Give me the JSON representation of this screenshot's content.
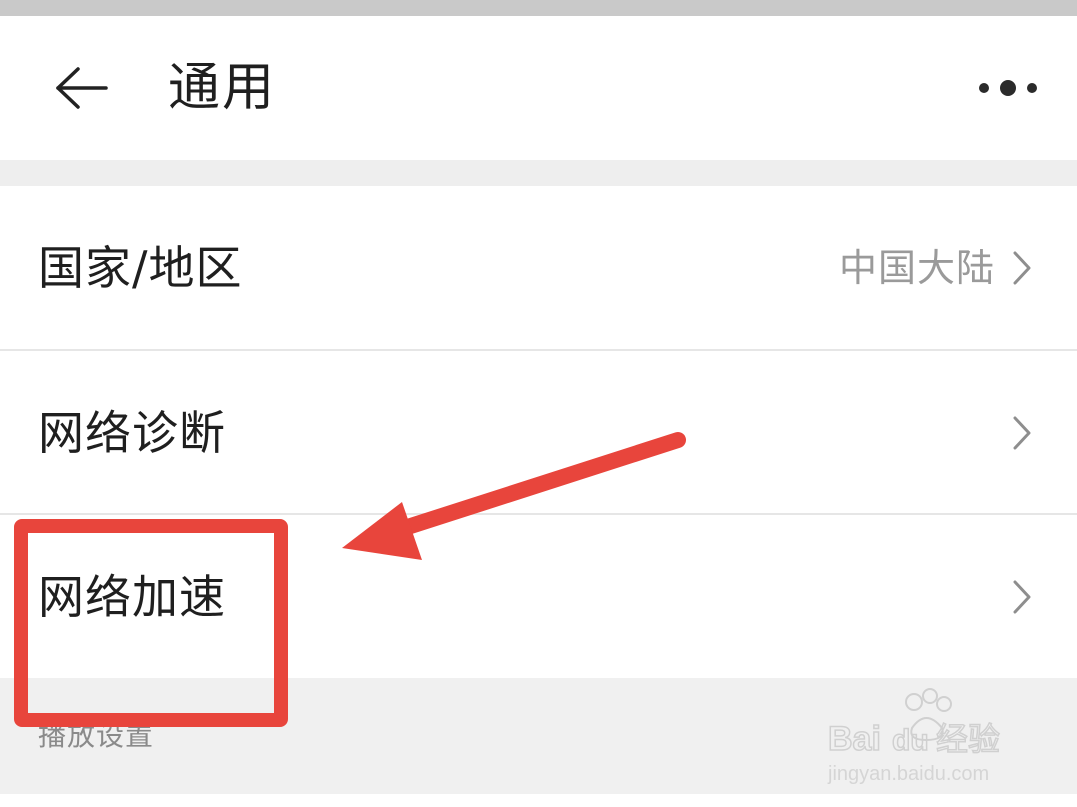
{
  "header": {
    "title": "通用",
    "back_icon": "arrow-left-icon",
    "more_icon": "more-dots-icon"
  },
  "settings": {
    "items": [
      {
        "label": "国家/地区",
        "value": "中国大陆",
        "icon": "chevron-right-icon"
      },
      {
        "label": "网络诊断",
        "value": "",
        "icon": "chevron-right-icon"
      },
      {
        "label": "网络加速",
        "value": "",
        "icon": "chevron-right-icon"
      }
    ],
    "section_label": "播放设置"
  },
  "annotation": {
    "highlight_color": "#e8453c",
    "arrow_color": "#e8453c",
    "highlighted_item": "网络加速"
  },
  "colors": {
    "primary_text": "#1f1f1f",
    "secondary_text": "#9a9a9a",
    "section_text": "#8a8a8a",
    "divider": "#e6e6e6",
    "section_bg": "#f0f0f0"
  }
}
